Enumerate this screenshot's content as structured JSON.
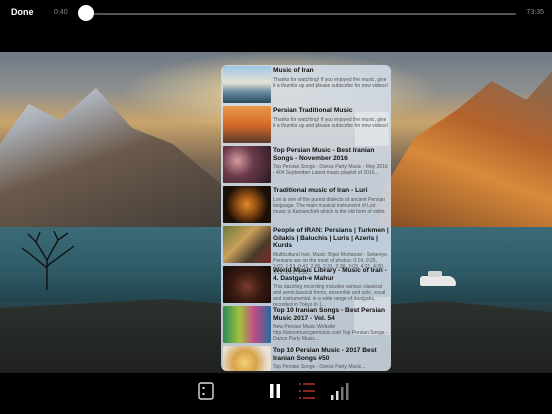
{
  "player": {
    "done_label": "Done",
    "elapsed": "0:40",
    "duration": "73:35",
    "progress": 0.005
  },
  "playlist": [
    {
      "title": "Music of Iran",
      "desc": "Thanks for watching! If you enjoyed the music, give it a thumbs up and please subscribe for new videos!"
    },
    {
      "title": "Persian Traditional Music",
      "desc": "Thanks for watching! If you enjoyed the music, give it a thumbs up and please subscribe for new videos!"
    },
    {
      "title": "Top Persian Music - Best Iranian Songs - November 2016",
      "desc": "Top Persian Songs - Dance Party Music - May 2016 - 404 September Latest music playlist of 2016..."
    },
    {
      "title": "Traditional music of Iran - Luri",
      "desc": "Lori is one of the purest dialects of ancient Persian language. The main musical instrument of Lori music is Kamancheh which is the old form of violin."
    },
    {
      "title": "People of IRAN: Persians | Turkmen | Gilakis | Baluchis | Luris | Azeris | Kurds",
      "desc": "Multicultural Iran, Music: Bijan Mortazavi - Setareye. Persians are on the most of photos: 0:14, 0:25, 1:03, 1:53, 0:47, 2:05, 2:31, 2:38, 3:03, 4:21, 4:30, 5:11, 5:21, 5:31..."
    },
    {
      "title": "World Music Library - Music of Iran - 4. Dastgah-e Mahur",
      "desc": "This dazzling recording includes various classical and semiclassical forms, ensemble and solo, vocal and instrumental, in a wide range of dastgahs, recorded in Tokyo in 1..."
    },
    {
      "title": "Top 10 Iranian Songs - Best Persian Music 2017 - Vol. 54",
      "desc": "New Persian Music Website http://tarnomusicgermusic.com Top Persian Songs - Dance Party Music..."
    },
    {
      "title": "Top 10 Persian Music - 2017 Best Iranian Songs #50",
      "desc": "Top Persian Songs - Dance Party Music..."
    }
  ],
  "colors": {
    "accent": "#c0392b",
    "playlist_bg": "#d2dce8"
  },
  "icons": {
    "list": "list-icon",
    "pause": "pause-icon",
    "queue": "queue-icon",
    "volume": "volume-bars-icon"
  }
}
